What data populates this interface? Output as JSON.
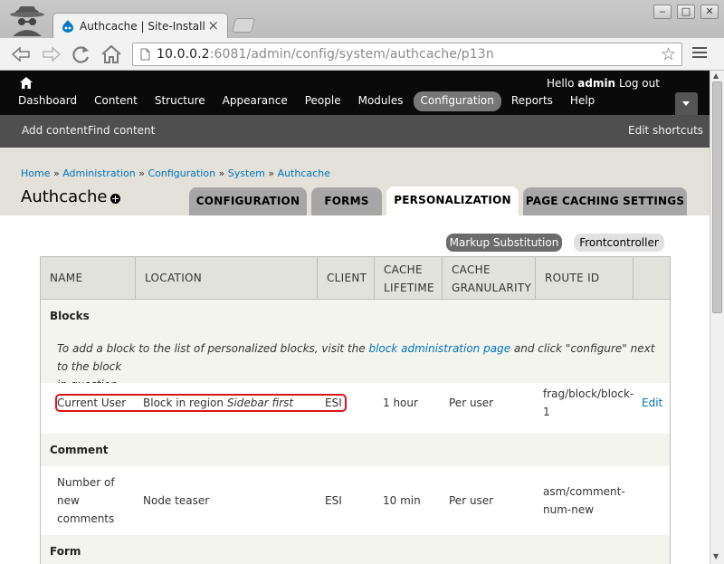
{
  "browser": {
    "tab_title": "Authcache | Site-Install",
    "tab_close": "×",
    "url_host": "10.0.0.2",
    "url_path": ":6081/admin/config/system/authcache/p13n",
    "window_buttons": [
      "‒",
      "□",
      "✕"
    ]
  },
  "admin_toolbar": {
    "hello": "Hello",
    "user": "admin",
    "logout": "Log out",
    "menu": [
      "Dashboard",
      "Content",
      "Structure",
      "Appearance",
      "People",
      "Modules",
      "Configuration",
      "Reports",
      "Help"
    ],
    "active_menu": "Configuration"
  },
  "shortcuts": {
    "add_content": "Add content",
    "find_content": "Find content",
    "edit_shortcuts": "Edit shortcuts"
  },
  "breadcrumb": [
    "Home",
    "Administration",
    "Configuration",
    "System",
    "Authcache"
  ],
  "breadcrumb_sep": "»",
  "page_title": "Authcache",
  "tabs": [
    "CONFIGURATION",
    "FORMS",
    "PERSONALIZATION",
    "PAGE CACHING SETTINGS"
  ],
  "active_tab": "PERSONALIZATION",
  "subtabs": {
    "markup": "Markup Substitution",
    "front": "Frontcontroller"
  },
  "table": {
    "headers": {
      "name": "NAME",
      "location": "LOCATION",
      "client": "CLIENT",
      "lifetime_1": "CACHE",
      "lifetime_2": "LIFETIME",
      "granularity_1": "CACHE",
      "granularity_2": "GRANULARITY",
      "route": "ROUTE ID"
    },
    "blocks_label": "Blocks",
    "blocks_note_pre": "To add a block to the list of personalized blocks, visit the",
    "blocks_note_link": "block administration page",
    "blocks_note_post_1": "and click \"configure\" next to the block",
    "blocks_note_post_2": "in question.",
    "row1": {
      "name": "Current User",
      "location_pre": "Block in region",
      "location_em": "Sidebar first",
      "client": "ESI",
      "lifetime": "1 hour",
      "granularity": "Per user",
      "route_1": "frag/block/block-",
      "route_2": "1",
      "edit": "Edit"
    },
    "comment_label": "Comment",
    "row2": {
      "name_1": "Number of",
      "name_2": "new",
      "name_3": "comments",
      "location": "Node teaser",
      "client": "ESI",
      "lifetime": "10 min",
      "granularity": "Per user",
      "route_1": "asm/comment-",
      "route_2": "num-new"
    },
    "form_label": "Form"
  }
}
